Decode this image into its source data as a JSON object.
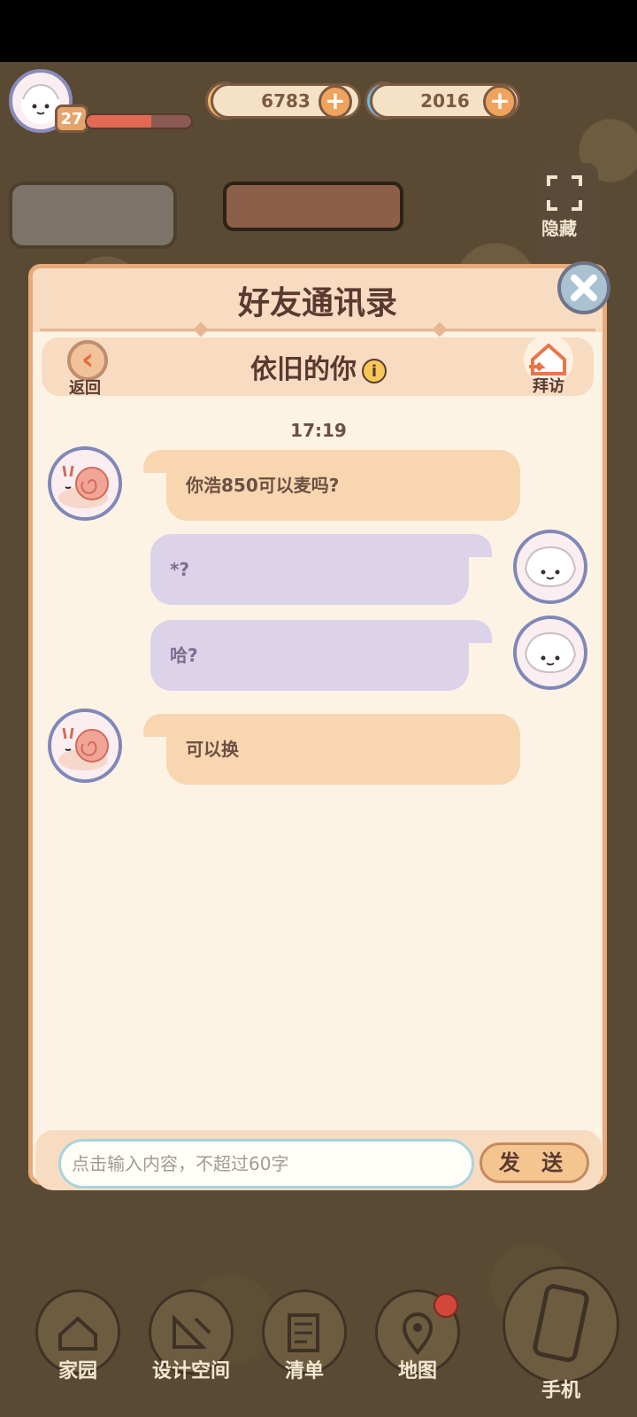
{
  "hud": {
    "level": "27",
    "exp_progress": 0.62,
    "coins": "6783",
    "gems": "2016",
    "hide_label": "隐藏"
  },
  "dialog": {
    "title": "好友通讯录",
    "back_label": "返回",
    "contact_name": "依旧的你",
    "info_symbol": "i",
    "visit_label": "拜访",
    "timestamp": "17:19",
    "messages": [
      {
        "side": "left",
        "text": "你浩850可以麦吗?"
      },
      {
        "side": "right",
        "text": "*?"
      },
      {
        "side": "right",
        "text": "哈?"
      },
      {
        "side": "left",
        "text": "可以换"
      }
    ],
    "input_placeholder": "点击输入内容，不超过60字",
    "send_label": "发 送"
  },
  "nav": {
    "items": [
      {
        "label": "家园"
      },
      {
        "label": "设计空间"
      },
      {
        "label": "清单"
      },
      {
        "label": "地图"
      },
      {
        "label": "手机"
      }
    ]
  },
  "icons": {
    "coin": "coin-icon",
    "gem": "swirl-gem-icon",
    "close": "close-icon",
    "back": "chevron-left-icon",
    "visit": "house-icon"
  },
  "colors": {
    "dialog_bg": "#fdf3e4",
    "left_bubble": "#f7d6b0",
    "right_bubble": "#dcd2ea",
    "accent": "#e9a97a"
  }
}
